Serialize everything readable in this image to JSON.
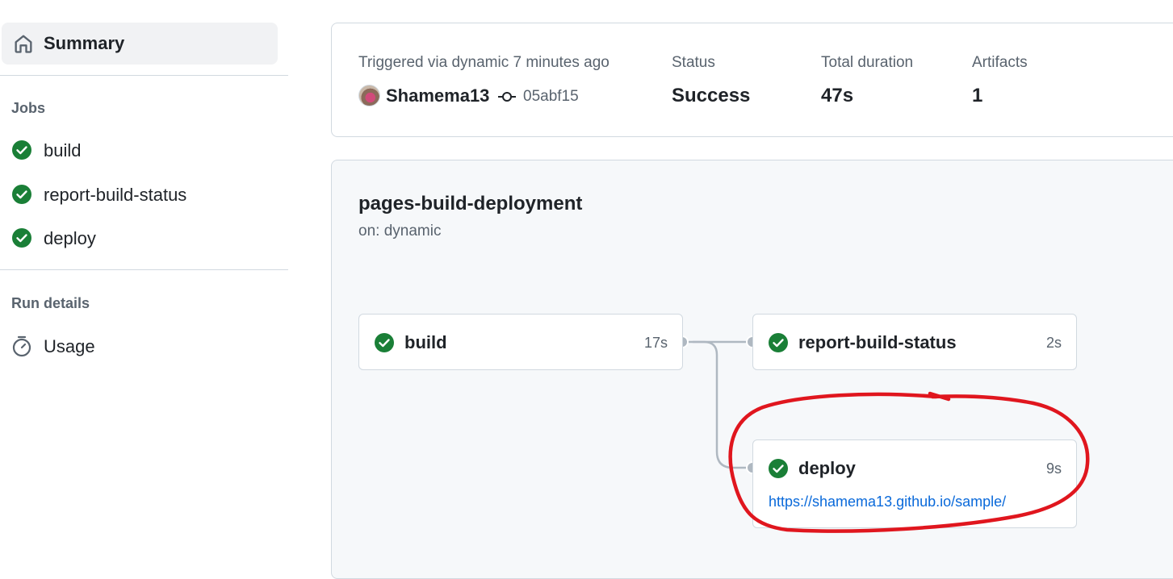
{
  "sidebar": {
    "summary_label": "Summary",
    "jobs_title": "Jobs",
    "jobs": [
      {
        "label": "build",
        "status": "success"
      },
      {
        "label": "report-build-status",
        "status": "success"
      },
      {
        "label": "deploy",
        "status": "success"
      }
    ],
    "run_details_title": "Run details",
    "usage_label": "Usage"
  },
  "run": {
    "triggered_text": "Triggered via dynamic 7 minutes ago",
    "actor": "Shamema13",
    "commit_sha": "05abf15",
    "status_label": "Status",
    "status_value": "Success",
    "duration_label": "Total duration",
    "duration_value": "47s",
    "artifacts_label": "Artifacts",
    "artifacts_value": "1"
  },
  "workflow": {
    "name": "pages-build-deployment",
    "trigger": "on: dynamic",
    "jobs": {
      "build": {
        "name": "build",
        "duration": "17s"
      },
      "report": {
        "name": "report-build-status",
        "duration": "2s"
      },
      "deploy": {
        "name": "deploy",
        "duration": "9s",
        "url": "https://shamema13.github.io/sample/"
      }
    }
  },
  "annotation": {
    "color": "#e0161e",
    "shape": "hand-drawn ellipse around deploy job"
  },
  "colors": {
    "success": "#1a7f37",
    "link": "#0969da",
    "muted": "#59636e"
  }
}
